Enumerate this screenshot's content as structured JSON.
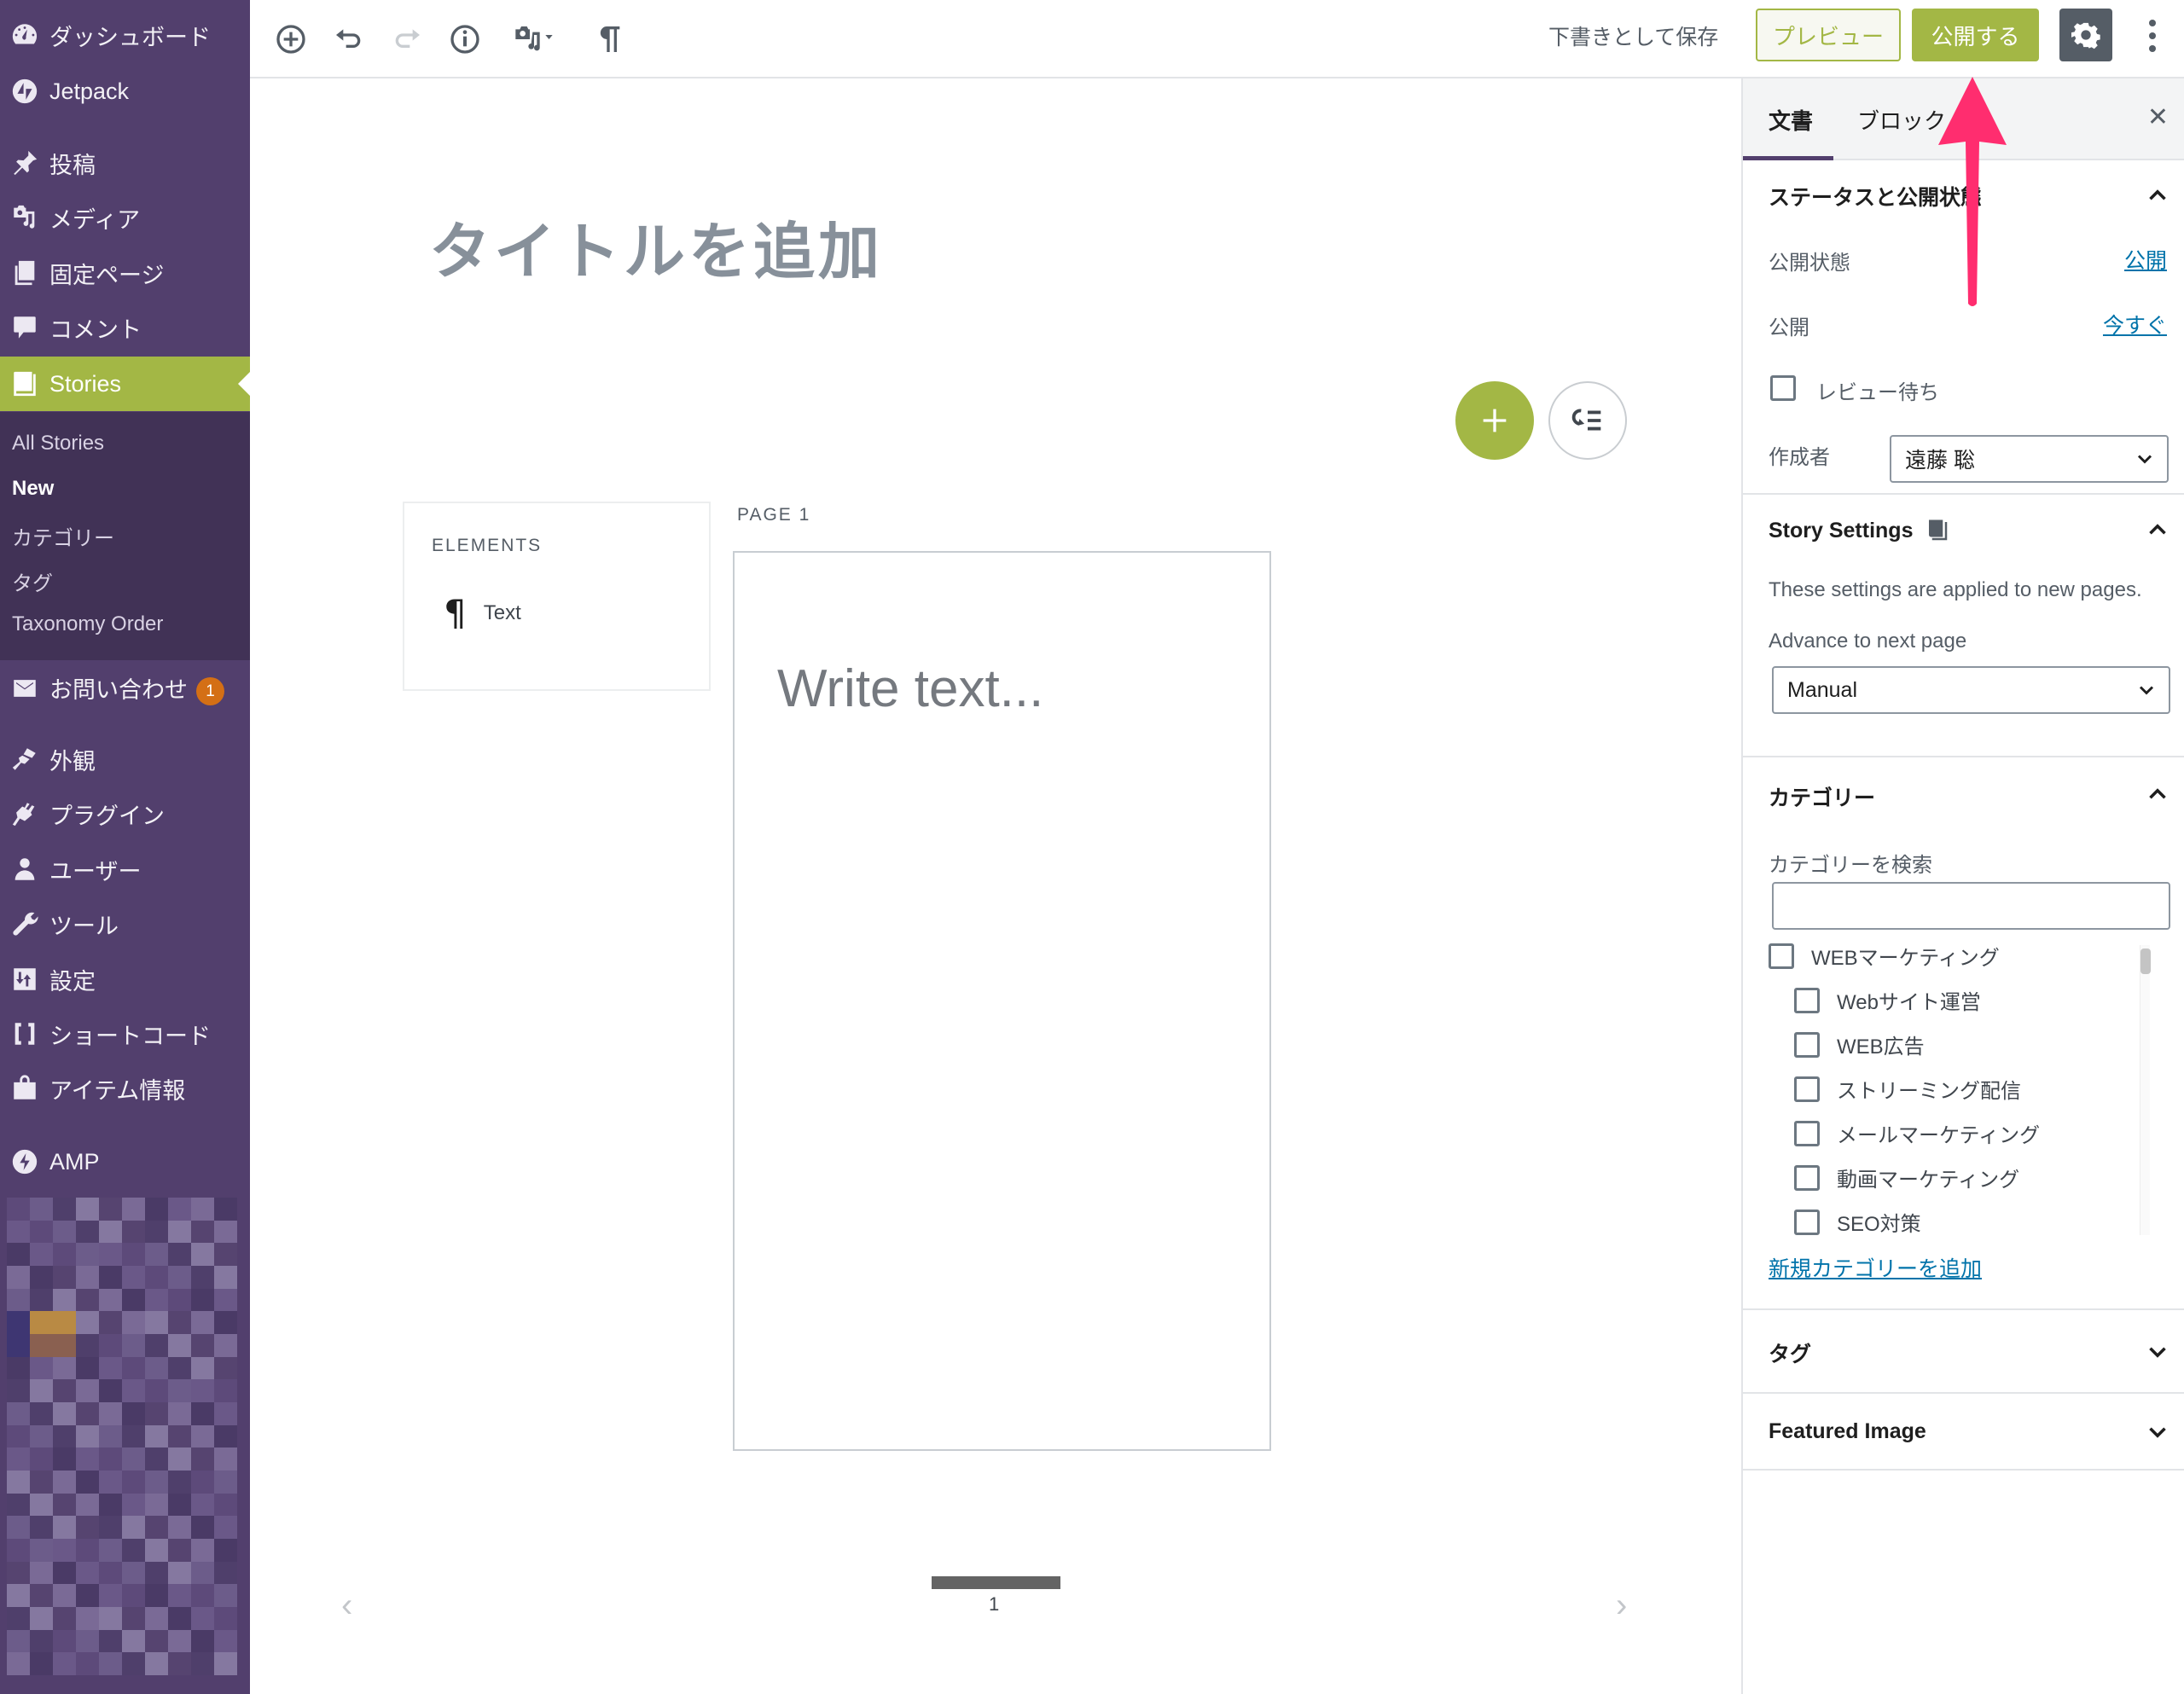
{
  "sidebar": {
    "items": [
      {
        "label": "ダッシュボード",
        "icon": "dashboard-icon"
      },
      {
        "label": "Jetpack",
        "icon": "jetpack-icon"
      },
      {
        "label": "投稿",
        "icon": "pin-icon"
      },
      {
        "label": "メディア",
        "icon": "media-icon"
      },
      {
        "label": "固定ページ",
        "icon": "pages-icon"
      },
      {
        "label": "コメント",
        "icon": "comment-icon"
      },
      {
        "label": "Stories",
        "icon": "book-icon",
        "active": true
      },
      {
        "label": "お問い合わせ",
        "icon": "mail-icon",
        "badge": "1"
      },
      {
        "label": "外観",
        "icon": "brush-icon"
      },
      {
        "label": "プラグイン",
        "icon": "plugin-icon"
      },
      {
        "label": "ユーザー",
        "icon": "user-icon"
      },
      {
        "label": "ツール",
        "icon": "wrench-icon"
      },
      {
        "label": "設定",
        "icon": "settings-icon"
      },
      {
        "label": "ショートコード",
        "icon": "shortcode-icon"
      },
      {
        "label": "アイテム情報",
        "icon": "bag-icon"
      },
      {
        "label": "AMP",
        "icon": "amp-icon"
      }
    ],
    "submenu": [
      {
        "label": "All Stories"
      },
      {
        "label": "New",
        "current": true
      },
      {
        "label": "カテゴリー"
      },
      {
        "label": "タグ"
      },
      {
        "label": "Taxonomy Order"
      }
    ]
  },
  "toolbar": {
    "icons": [
      "add-block-icon",
      "undo-icon",
      "redo-icon",
      "info-icon",
      "media-icon",
      "pilcrow-icon"
    ],
    "save_draft": "下書きとして保存",
    "preview": "プレビュー",
    "publish": "公開する"
  },
  "editor": {
    "title_placeholder": "タイトルを追加",
    "elements_title": "ELEMENTS",
    "element_text": "Text",
    "page_label": "PAGE 1",
    "text_placeholder": "Write text...",
    "current_page": "1"
  },
  "panel": {
    "tabs": {
      "document": "文書",
      "block": "ブロック"
    },
    "close": "✕",
    "status": {
      "title": "ステータスと公開状態",
      "visibility_label": "公開状態",
      "visibility_value": "公開",
      "publish_label": "公開",
      "publish_value": "今すぐ",
      "pending_review": "レビュー待ち",
      "author_label": "作成者",
      "author_value": "遠藤 聡"
    },
    "story_settings": {
      "title": "Story Settings",
      "description": "These settings are applied to new pages.",
      "advance_label": "Advance to next page",
      "advance_value": "Manual"
    },
    "categories": {
      "title": "カテゴリー",
      "search_label": "カテゴリーを検索",
      "search_value": "",
      "items": [
        {
          "label": "WEBマーケティング",
          "level": 0,
          "checked": false
        },
        {
          "label": "Webサイト運営",
          "level": 1,
          "checked": false
        },
        {
          "label": "WEB広告",
          "level": 1,
          "checked": false
        },
        {
          "label": "ストリーミング配信",
          "level": 1,
          "checked": false
        },
        {
          "label": "メールマーケティング",
          "level": 1,
          "checked": false
        },
        {
          "label": "動画マーケティング",
          "level": 1,
          "checked": false
        },
        {
          "label": "SEO対策",
          "level": 1,
          "checked": false
        }
      ],
      "add_new": "新規カテゴリーを追加"
    },
    "tags": {
      "title": "タグ"
    },
    "featured_image": {
      "title": "Featured Image"
    }
  },
  "colors": {
    "sidebar_bg": "#523f6d",
    "submenu_bg": "#413256",
    "accent": "#a3b745",
    "badge": "#d46f15",
    "link": "#0073aa",
    "annotation_arrow": "#ff2d6f"
  }
}
